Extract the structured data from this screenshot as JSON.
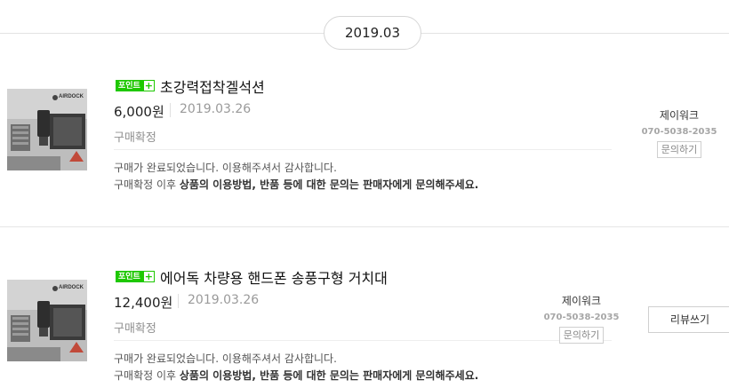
{
  "month": "2019.03",
  "orders": [
    {
      "thumb_brand": "AIRDOCK",
      "badge_text": "포인트",
      "badge_plus": "+",
      "title": "초강력접착겔석션",
      "price": "6,000원",
      "date": "2019.03.26",
      "status": "구매확정",
      "message_line1": "구매가 완료되었습니다. 이용해주셔서 감사합니다.",
      "message_line2_pre": "구매확정 이후 ",
      "message_line2_bold": "상품의 이용방법, 반품 등에 대한 문의는 판매자에게 문의해주세요.",
      "seller_name": "제이워크",
      "seller_phone": "070-5038-2035",
      "inquiry_label": "문의하기"
    },
    {
      "thumb_brand": "AIRDOCK",
      "badge_text": "포인트",
      "badge_plus": "+",
      "title": "에어독 차량용 핸드폰 송풍구형 거치대",
      "price": "12,400원",
      "date": "2019.03.26",
      "status": "구매확정",
      "message_line1": "구매가 완료되었습니다. 이용해주셔서 감사합니다.",
      "message_line2_pre": "구매확정 이후 ",
      "message_line2_bold": "상품의 이용방법, 반품 등에 대한 문의는 판매자에게 문의해주세요.",
      "seller_name": "제이워크",
      "seller_phone": "070-5038-2035",
      "inquiry_label": "문의하기",
      "review_label": "리뷰쓰기"
    }
  ],
  "colors": {
    "point_green": "#1ec800",
    "muted_text": "#9a9a9a"
  }
}
